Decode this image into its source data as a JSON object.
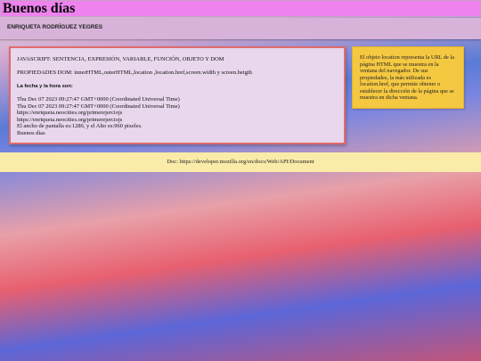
{
  "header": {
    "title": "Buenos días"
  },
  "author": {
    "name": "ENRIQUETA RODRÍGUEZ YEGRES"
  },
  "main": {
    "topics": "JAVASCRIPT: SENTENCIA, EXPRESIÓN, VARIABLE, FUNCIÓN, OBJETO Y DOM",
    "dom_props": "PROPIEDADES DOM: innerHTML,outerHTML,location ,location.href,screen.width y screen.heigth",
    "heading": "La fecha y la hora son:",
    "lines": [
      "Thu Dec 07 2023 09:27:47 GMT+0000 (Coordinated Universal Time)",
      "Thu Dec 07 2023 09:27:47 GMT+0000 (Coordinated Universal Time)",
      "https://enriqueta.neocities.org/primerejerciojs",
      "https://enriqueta.neocities.org/primerejerciojs",
      "El ancho de pantalla es:1280, y el Alto es:960 pixeles.",
      "Buenos días"
    ]
  },
  "sidebar": {
    "text": "El objeto location representa la URL de la página HTML que se muestra en la ventana del navegador. De sus propiedades, la más utilizada es location.href, que permite obtener o establecer la dirección de la página que se muestra en dicha ventana."
  },
  "footer": {
    "doc": "Doc: https://developer.mozilla.org/en/docs/Web/API/Document"
  }
}
